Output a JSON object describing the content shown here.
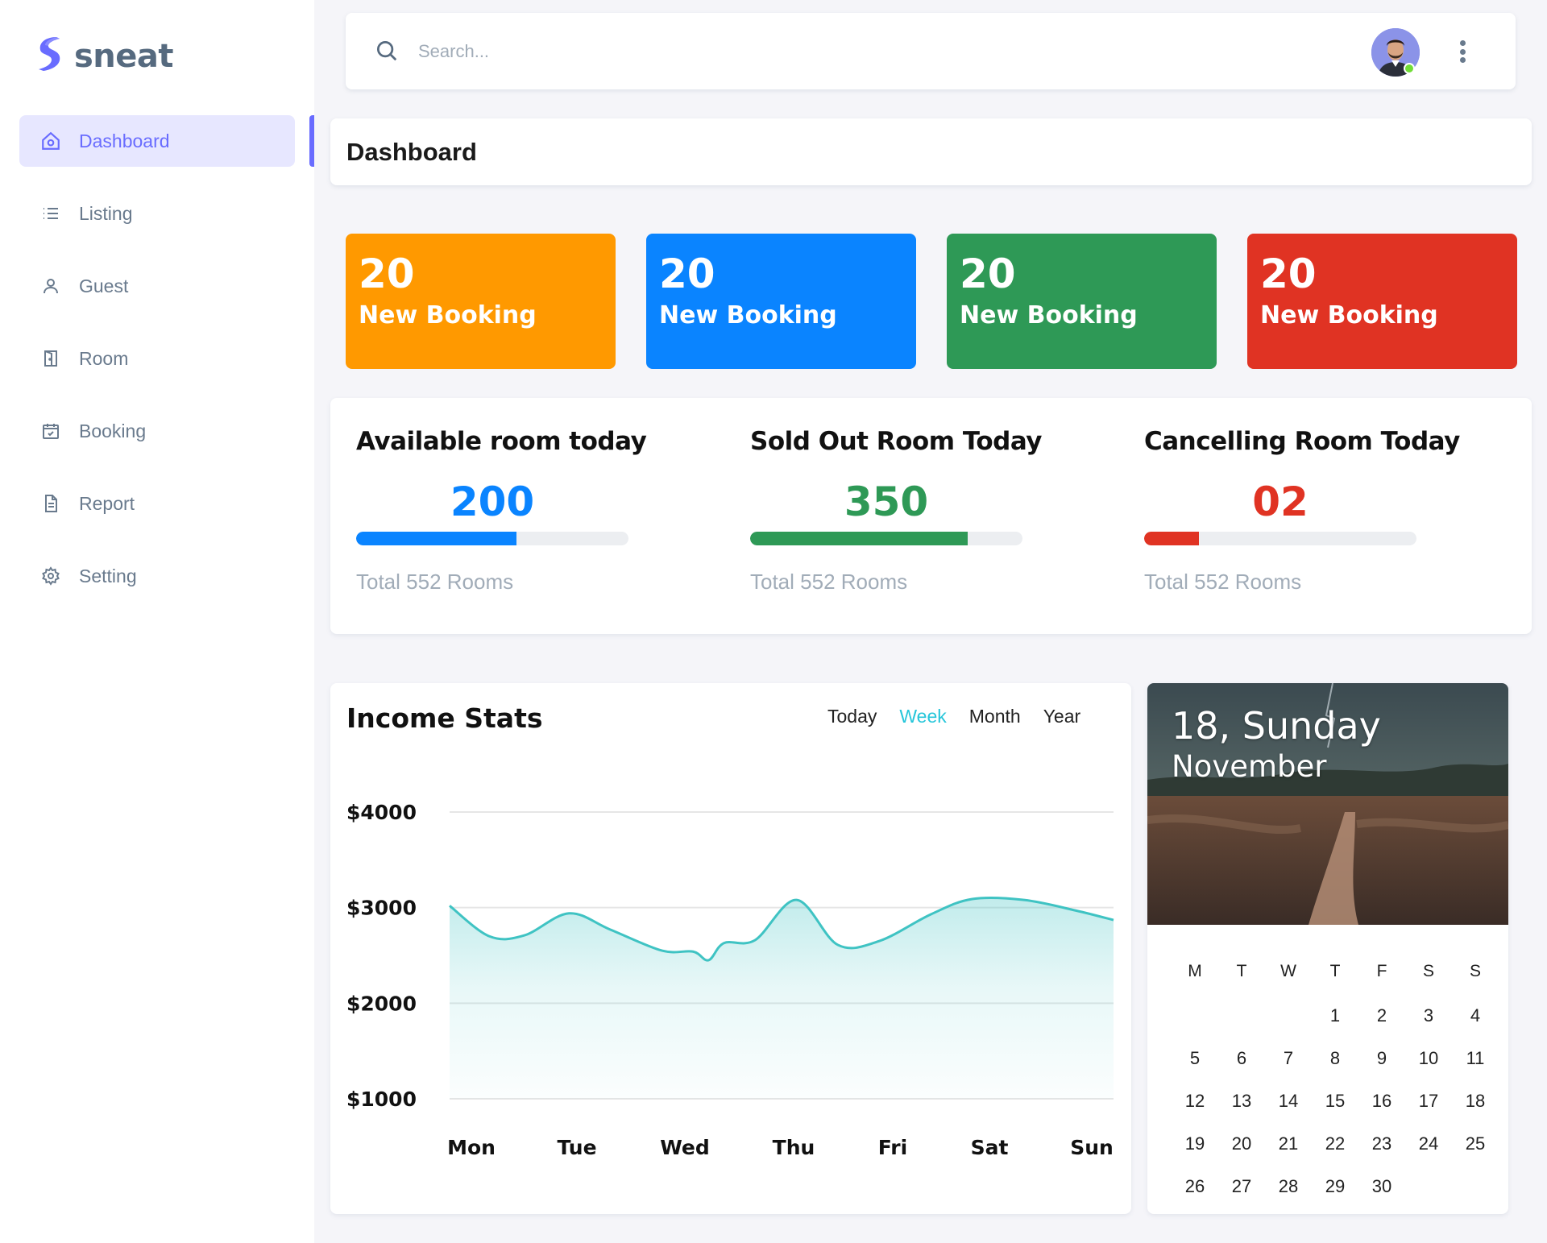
{
  "brand": {
    "name": "sneat",
    "color": "#696cff"
  },
  "sidebar": {
    "items": [
      {
        "label": "Dashboard",
        "icon": "home-icon",
        "active": true
      },
      {
        "label": "Listing",
        "icon": "list-icon"
      },
      {
        "label": "Guest",
        "icon": "user-icon"
      },
      {
        "label": "Room",
        "icon": "door-icon"
      },
      {
        "label": "Booking",
        "icon": "calendar-check-icon"
      },
      {
        "label": "Report",
        "icon": "file-icon"
      },
      {
        "label": "Setting",
        "icon": "gear-icon"
      }
    ]
  },
  "topbar": {
    "search_placeholder": "Search...",
    "avatar_status": "online"
  },
  "page": {
    "title": "Dashboard"
  },
  "stats": [
    {
      "value": "20",
      "label": "New Booking",
      "color": "#ff9900"
    },
    {
      "value": "20",
      "label": "New Booking",
      "color": "#0a84ff"
    },
    {
      "value": "20",
      "label": "New Booking",
      "color": "#2e9956"
    },
    {
      "value": "20",
      "label": "New Booking",
      "color": "#e03323"
    }
  ],
  "rooms": [
    {
      "title": "Available room today",
      "value": "200",
      "progress": 0.59,
      "color": "#0a84ff",
      "total": "Total 552 Rooms"
    },
    {
      "title": "Sold Out Room Today",
      "value": "350",
      "progress": 0.8,
      "color": "#2e9956",
      "total": "Total 552 Rooms"
    },
    {
      "title": "Cancelling Room Today",
      "value": "02",
      "progress": 0.2,
      "color": "#e03323",
      "total": "Total 552 Rooms"
    }
  ],
  "income": {
    "title": "Income Stats",
    "tabs": [
      "Today",
      "Week",
      "Month",
      "Year"
    ],
    "active_tab": "Week"
  },
  "chart_data": {
    "type": "area",
    "xlabel": "",
    "ylabel": "",
    "ytick_labels": [
      "$4000",
      "$3000",
      "$2000",
      "$1000"
    ],
    "y_ticks": [
      4000,
      3000,
      2000,
      1000
    ],
    "ylim": [
      1000,
      4000
    ],
    "x": [
      "Mon",
      "Tue",
      "Wed",
      "Thu",
      "Fri",
      "Sat",
      "Sun"
    ],
    "grid": true,
    "series": [
      {
        "color": "#3fc3c3",
        "x": [
          0,
          0.33,
          0.67,
          1.1,
          1.5,
          2.0,
          2.3,
          2.45,
          2.6,
          2.9,
          3.3,
          3.7,
          4.1,
          4.6,
          5.0,
          5.5,
          6.0,
          6.25
        ],
        "values": [
          3020,
          2700,
          2710,
          2940,
          2770,
          2550,
          2540,
          2450,
          2630,
          2660,
          3080,
          2610,
          2650,
          2930,
          3090,
          3080,
          2970,
          2870
        ]
      }
    ]
  },
  "calendar": {
    "date_line": "18, Sunday",
    "month": "November",
    "weekdays": [
      "M",
      "T",
      "W",
      "T",
      "F",
      "S",
      "S"
    ],
    "first_weekday_index": 3,
    "days": [
      "1",
      "2",
      "3",
      "4",
      "5",
      "6",
      "7",
      "8",
      "9",
      "10",
      "11",
      "12",
      "13",
      "14",
      "15",
      "16",
      "17",
      "18",
      "19",
      "20",
      "21",
      "22",
      "23",
      "24",
      "25",
      "26",
      "27",
      "28",
      "29",
      "30"
    ]
  }
}
